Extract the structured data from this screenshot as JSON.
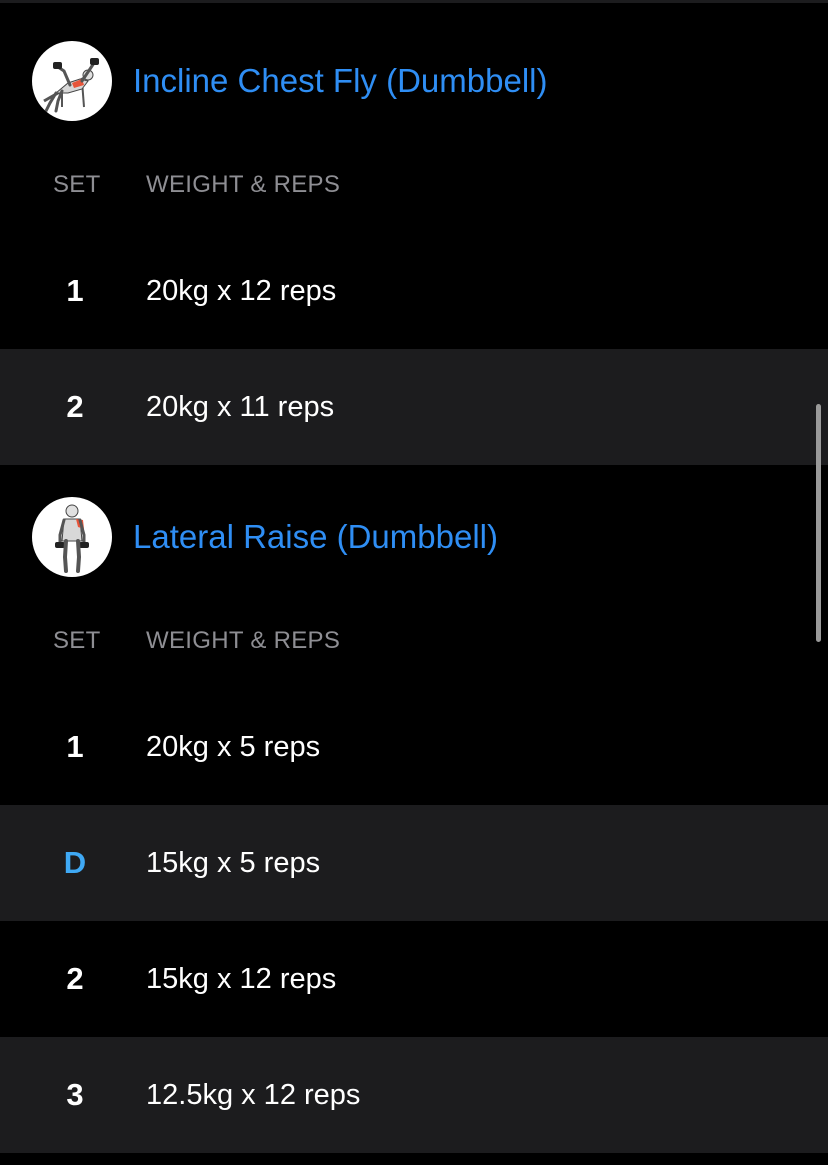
{
  "colors": {
    "background": "#000000",
    "row_alt": "#1c1c1e",
    "title_accent": "#2f8ef4",
    "drop_set_accent": "#3fa9f5",
    "header_text": "#8e8e93",
    "muscle_highlight": "#e8553a"
  },
  "exercises": [
    {
      "title": "Incline Chest Fly (Dumbbell)",
      "thumbnail_icon": "incline-chest-fly-figure-icon",
      "headers": {
        "set": "SET",
        "weight_reps": "WEIGHT & REPS"
      },
      "sets": [
        {
          "set": "1",
          "value": "20kg x 12 reps",
          "type": "normal"
        },
        {
          "set": "2",
          "value": "20kg x 11 reps",
          "type": "normal"
        }
      ]
    },
    {
      "title": "Lateral Raise (Dumbbell)",
      "thumbnail_icon": "lateral-raise-figure-icon",
      "headers": {
        "set": "SET",
        "weight_reps": "WEIGHT & REPS"
      },
      "sets": [
        {
          "set": "1",
          "value": "20kg x 5 reps",
          "type": "normal"
        },
        {
          "set": "D",
          "value": "15kg x 5 reps",
          "type": "drop"
        },
        {
          "set": "2",
          "value": "15kg x 12 reps",
          "type": "normal"
        },
        {
          "set": "3",
          "value": "12.5kg x 12 reps",
          "type": "normal"
        }
      ]
    }
  ]
}
